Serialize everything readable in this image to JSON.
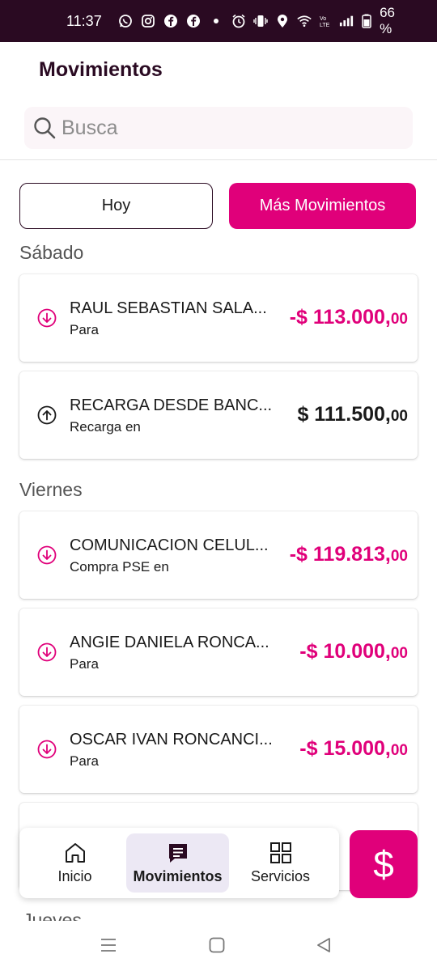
{
  "status_bar": {
    "time": "11:37",
    "battery": "66 %",
    "icons": [
      "whatsapp-icon",
      "instagram-icon",
      "facebook-icon",
      "facebook-icon",
      "dot-icon",
      "alarm-icon",
      "vibrate-icon",
      "location-icon",
      "wifi-icon",
      "volte-icon",
      "signal-icon",
      "battery-icon"
    ]
  },
  "header": {
    "title": "Movimientos"
  },
  "search": {
    "placeholder": "Busca"
  },
  "filters": {
    "today": "Hoy",
    "more": "Más Movimientos"
  },
  "sections": [
    {
      "label": "Sábado",
      "transactions": [
        {
          "name": "RAUL SEBASTIAN SALA...",
          "subtitle": "Para",
          "amount": "-$ 113.000,",
          "decimals": "00",
          "direction": "out"
        },
        {
          "name": "RECARGA DESDE BANC...",
          "subtitle": "Recarga en",
          "amount": "$ 111.500,",
          "decimals": "00",
          "direction": "in"
        }
      ]
    },
    {
      "label": "Viernes",
      "transactions": [
        {
          "name": "COMUNICACION CELUL...",
          "subtitle": "Compra PSE en",
          "amount": "-$ 119.813,",
          "decimals": "00",
          "direction": "out"
        },
        {
          "name": "ANGIE DANIELA RONCA...",
          "subtitle": "Para",
          "amount": "-$ 10.000,",
          "decimals": "00",
          "direction": "out"
        },
        {
          "name": "OSCAR IVAN RONCANCI...",
          "subtitle": "Para",
          "amount": "-$ 15.000,",
          "decimals": "00",
          "direction": "out"
        }
      ]
    },
    {
      "label": "Jueves"
    }
  ],
  "bottom_nav": [
    {
      "label": "Inicio",
      "icon": "home-icon"
    },
    {
      "label": "Movimientos",
      "icon": "movements-icon",
      "active": true
    },
    {
      "label": "Servicios",
      "icon": "grid-icon"
    }
  ],
  "fab": {
    "symbol": "$"
  },
  "colors": {
    "brand": "#e0007a",
    "status_bar": "#2a0a22",
    "nav_active": "#ece8f4"
  }
}
